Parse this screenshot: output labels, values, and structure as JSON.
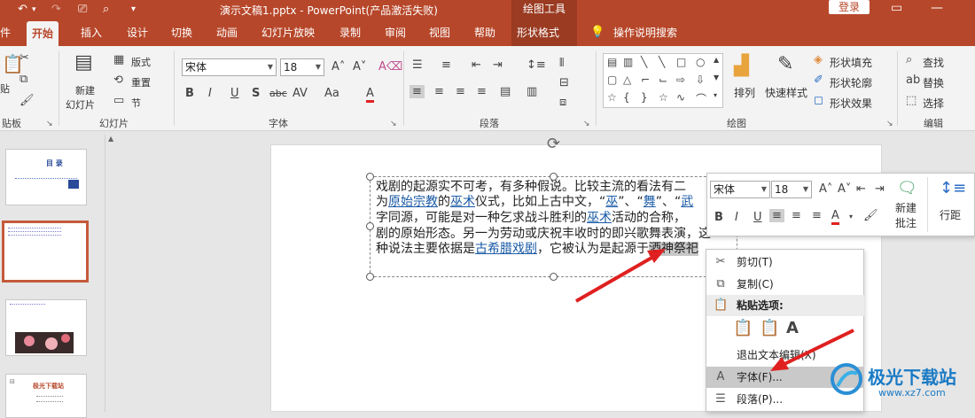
{
  "titlebar": {
    "title": "演示文稿1.pptx  -  PowerPoint(产品激活失败)",
    "context_group": "绘图工具",
    "login": "登录",
    "icons": [
      "undo-icon",
      "redo-icon",
      "present-icon",
      "print-preview-icon",
      "customize-icon"
    ]
  },
  "tabs": [
    {
      "label": "件"
    },
    {
      "label": "开始"
    },
    {
      "label": "插入"
    },
    {
      "label": "设计"
    },
    {
      "label": "切换"
    },
    {
      "label": "动画"
    },
    {
      "label": "幻灯片放映"
    },
    {
      "label": "录制"
    },
    {
      "label": "审阅"
    },
    {
      "label": "视图"
    },
    {
      "label": "帮助"
    },
    {
      "label": "形状格式"
    },
    {
      "label": "操作说明搜索"
    }
  ],
  "ribbon": {
    "groups": {
      "clipboard": "贴板",
      "slides": "幻灯片",
      "font": "字体",
      "paragraph": "段落",
      "drawing": "绘图",
      "editing": "编辑"
    },
    "paste_label": "贴",
    "new_slide": [
      "新建",
      "幻灯片"
    ],
    "layout": "版式",
    "reset": "重置",
    "section": "节",
    "font_name": "宋体",
    "font_size": "18",
    "arrange": "排列",
    "quick_styles": "快速样式",
    "shape_fill": "形状填充",
    "shape_outline": "形状轮廓",
    "shape_effects": "形状效果",
    "find": "查找",
    "replace": "替换",
    "select": "选择"
  },
  "slide_text": {
    "line1": "戏剧的起源实不可考，有多种假说。比较主流的看法有二",
    "line2a": "为",
    "line2_link1": "原始宗教",
    "line2b": "的",
    "line2_link2": "巫术",
    "line2c": "仪式，比如上古中文，“",
    "line2_link3": "巫",
    "line2d": "”、“",
    "line2_link4": "舞",
    "line2e": "”、“",
    "line2_link5": "武",
    "line3a": "字同源，可能是对一种乞求战斗胜利的",
    "line3_link": "巫术",
    "line3b": "活动的合称，",
    "line4": "剧的原始形态。另一为劳动或庆祝丰收时的即兴歌舞表演，这",
    "line5a": "种说法主要依据是",
    "line5_link": "古希腊戏剧",
    "line5b": "，它被认为是起源于",
    "line5_sel": "酒神祭祀"
  },
  "mini_toolbar": {
    "font_name": "宋体",
    "font_size": "18",
    "new_comment": [
      "新建",
      "批注"
    ],
    "line_spacing": "行距"
  },
  "context_menu": {
    "items": [
      {
        "label": "剪切(T)",
        "icon": "scissors-icon"
      },
      {
        "label": "复制(C)",
        "icon": "copy-icon"
      },
      {
        "label": "粘贴选项:",
        "icon": "paste-icon"
      },
      {
        "label": "退出文本编辑(X)",
        "icon": ""
      },
      {
        "label": "字体(F)...",
        "icon": "font-icon"
      },
      {
        "label": "段落(P)...",
        "icon": "paragraph-icon"
      }
    ]
  },
  "thumbnails": {
    "slide1_title": "目  录",
    "slide4_title": "极光下载站"
  },
  "watermark": {
    "text": "极光下载站",
    "url": "www.xz7.com"
  },
  "colors": {
    "accent": "#b7472a",
    "arrow": "#e02020"
  }
}
